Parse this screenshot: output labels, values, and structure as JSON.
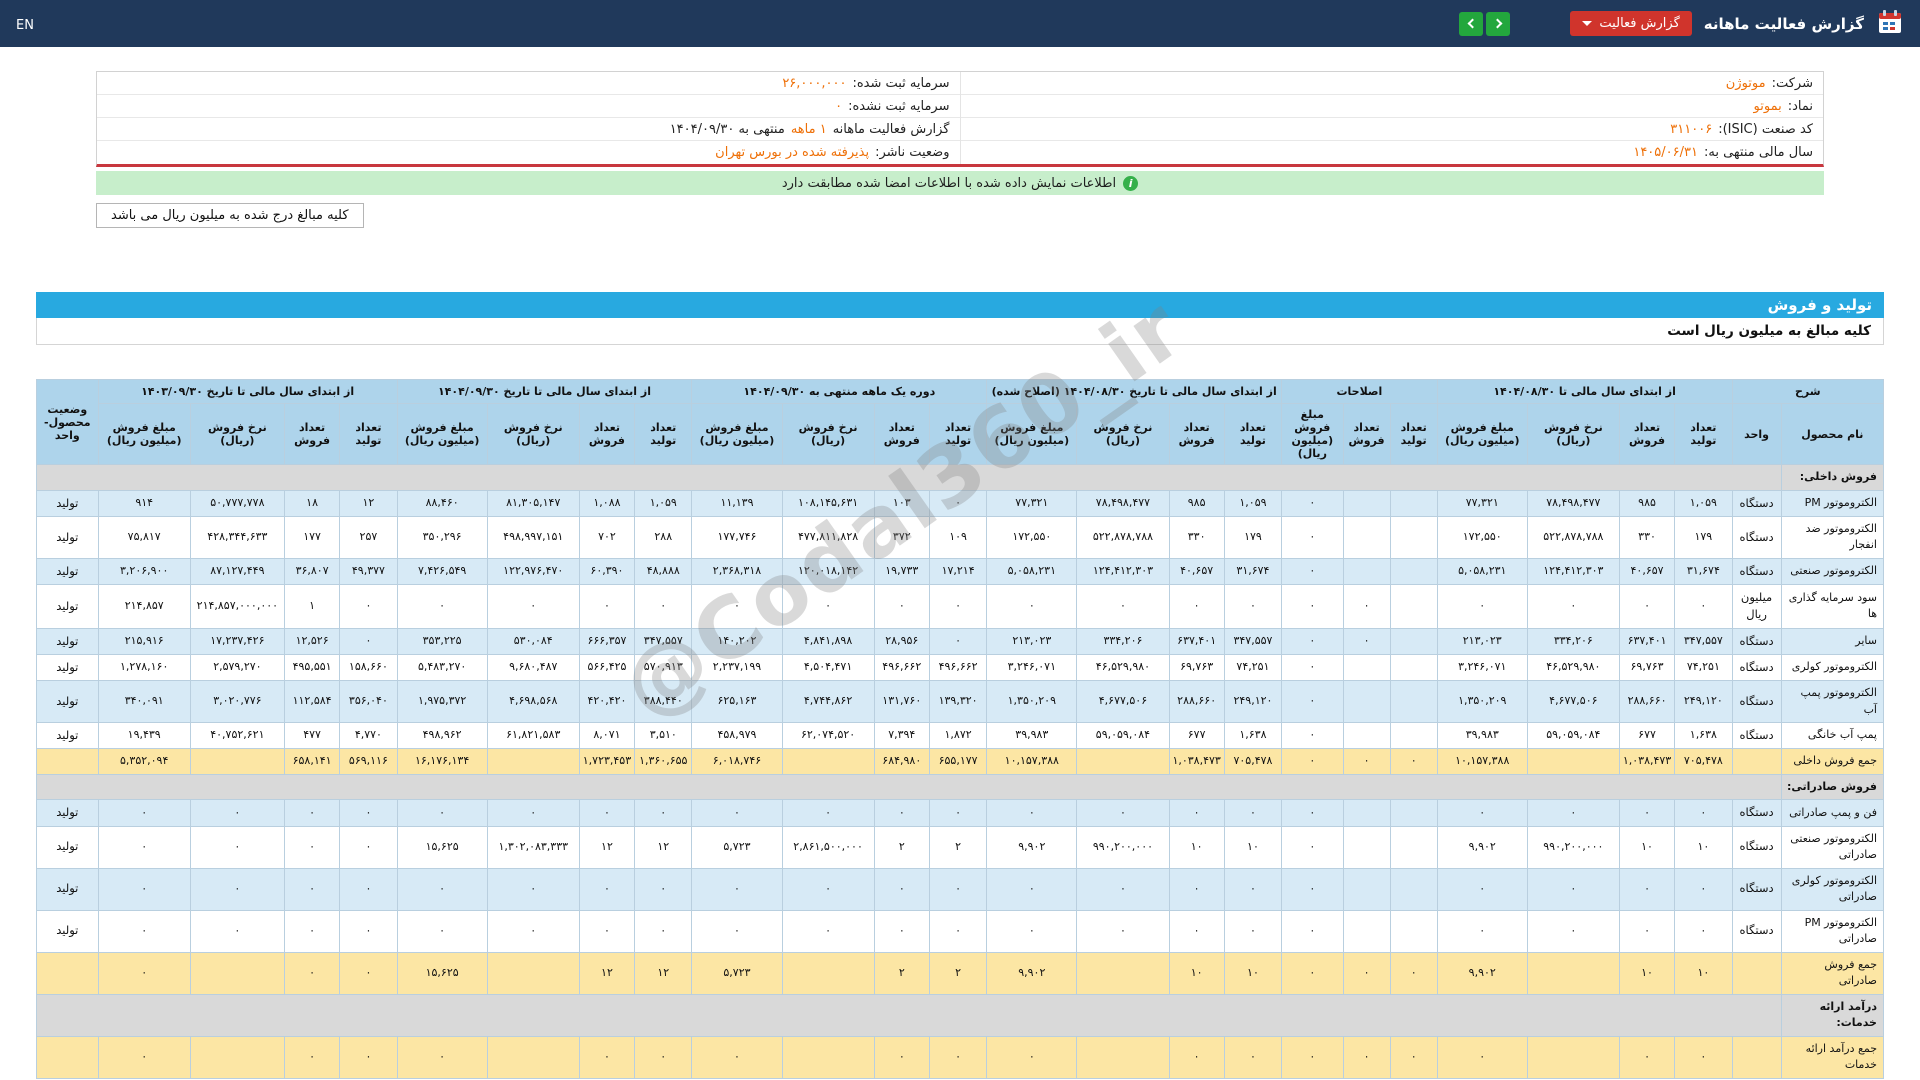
{
  "topbar": {
    "title": "گزارش فعالیت ماهانه",
    "report_button": "گزارش فعالیت",
    "lang": "EN"
  },
  "icons": {
    "info": "i"
  },
  "info": {
    "right": [
      {
        "label": "شرکت:",
        "value": "موتوژن"
      },
      {
        "label": "نماد:",
        "value": "بموتو"
      },
      {
        "label": "کد صنعت (ISIC):",
        "value": "۳۱۱۰۰۶"
      },
      {
        "label": "سال مالی منتهی به:",
        "value": "۱۴۰۵/۰۶/۳۱"
      }
    ],
    "left": [
      {
        "label": "سرمایه ثبت شده:",
        "value": "۲۶,۰۰۰,۰۰۰",
        "post": ""
      },
      {
        "label": "سرمایه ثبت نشده:",
        "value": "۰",
        "post": ""
      },
      {
        "label": "گزارش فعالیت ماهانه",
        "value": "۱ ماهه",
        "post": "منتهی به ۱۴۰۴/۰۹/۳۰"
      },
      {
        "label": "وضعیت ناشر:",
        "value": "پذیرفته شده در بورس تهران",
        "post": ""
      }
    ]
  },
  "banner": {
    "text": "اطلاعات نمایش داده شده با اطلاعات امضا شده مطابقت دارد"
  },
  "note": "کلیه مبالغ درج شده به میلیون ریال می باشد",
  "section_title": "تولید و فروش",
  "subtitle": "کلیه مبالغ به میلیون ریال است",
  "watermark": "@Codal360_ir",
  "table": {
    "groups": [
      {
        "title": "شرح",
        "cols": [
          "نام محصول",
          "واحد"
        ]
      },
      {
        "title": "از ابتدای سال مالی تا ۱۴۰۴/۰۸/۳۰",
        "cols": [
          "تعداد تولید",
          "تعداد فروش",
          "نرخ فروش (ریال)",
          "مبلغ فروش (میلیون ریال)"
        ]
      },
      {
        "title": "اصلاحات",
        "cols": [
          "تعداد تولید",
          "تعداد فروش",
          "مبلغ فروش (میلیون ریال)"
        ]
      },
      {
        "title": "از ابتدای سال مالی تا تاریخ ۱۴۰۴/۰۸/۳۰ (اصلاح شده)",
        "cols": [
          "تعداد تولید",
          "تعداد فروش",
          "نرخ فروش (ریال)",
          "مبلغ فروش (میلیون ریال)"
        ]
      },
      {
        "title": "دوره یک ماهه منتهی به ۱۴۰۴/۰۹/۳۰",
        "cols": [
          "تعداد تولید",
          "تعداد فروش",
          "نرخ فروش (ریال)",
          "مبلغ فروش (میلیون ریال)"
        ]
      },
      {
        "title": "از ابتدای سال مالی تا تاریخ ۱۴۰۴/۰۹/۳۰",
        "cols": [
          "تعداد تولید",
          "تعداد فروش",
          "نرخ فروش (ریال)",
          "مبلغ فروش (میلیون ریال)"
        ]
      },
      {
        "title": "از ابتدای سال مالی تا تاریخ ۱۴۰۳/۰۹/۳۰",
        "cols": [
          "تعداد تولید",
          "تعداد فروش",
          "نرخ فروش (ریال)",
          "مبلغ فروش (میلیون ریال)"
        ]
      },
      {
        "title": "وضعیت محصول-واحد",
        "cols": []
      }
    ],
    "rows": [
      {
        "type": "section",
        "name": "فروش داخلی:"
      },
      {
        "type": "data",
        "shade": "b",
        "name": "الکتروموتور PM",
        "unit": "دستگاه",
        "status": "تولید",
        "g2": [
          "۱,۰۵۹",
          "۹۸۵",
          "۷۸,۴۹۸,۴۷۷",
          "۷۷,۳۲۱"
        ],
        "adj": [
          "",
          "",
          "۰"
        ],
        "g4": [
          "۱,۰۵۹",
          "۹۸۵",
          "۷۸,۴۹۸,۴۷۷",
          "۷۷,۳۲۱"
        ],
        "m": [
          "۰",
          "۱۰۳",
          "۱۰۸,۱۴۵,۶۳۱",
          "۱۱,۱۳۹"
        ],
        "g6": [
          "۱,۰۵۹",
          "۱,۰۸۸",
          "۸۱,۳۰۵,۱۴۷",
          "۸۸,۴۶۰"
        ],
        "g7": [
          "۱۲",
          "۱۸",
          "۵۰,۷۷۷,۷۷۸",
          "۹۱۴"
        ]
      },
      {
        "type": "data",
        "shade": "w",
        "name": "الکتروموتور ضد انفجار",
        "unit": "دستگاه",
        "status": "تولید",
        "g2": [
          "۱۷۹",
          "۳۳۰",
          "۵۲۲,۸۷۸,۷۸۸",
          "۱۷۲,۵۵۰"
        ],
        "adj": [
          "",
          "",
          "۰"
        ],
        "g4": [
          "۱۷۹",
          "۳۳۰",
          "۵۲۲,۸۷۸,۷۸۸",
          "۱۷۲,۵۵۰"
        ],
        "m": [
          "۱۰۹",
          "۳۷۲",
          "۴۷۷,۸۱۱,۸۲۸",
          "۱۷۷,۷۴۶"
        ],
        "g6": [
          "۲۸۸",
          "۷۰۲",
          "۴۹۸,۹۹۷,۱۵۱",
          "۳۵۰,۲۹۶"
        ],
        "g7": [
          "۲۵۷",
          "۱۷۷",
          "۴۲۸,۳۴۴,۶۳۳",
          "۷۵,۸۱۷"
        ]
      },
      {
        "type": "data",
        "shade": "b",
        "name": "الکتروموتور صنعتی",
        "unit": "دستگاه",
        "status": "تولید",
        "g2": [
          "۳۱,۶۷۴",
          "۴۰,۶۵۷",
          "۱۲۴,۴۱۲,۳۰۳",
          "۵,۰۵۸,۲۳۱"
        ],
        "adj": [
          "",
          "",
          "۰"
        ],
        "g4": [
          "۳۱,۶۷۴",
          "۴۰,۶۵۷",
          "۱۲۴,۴۱۲,۳۰۳",
          "۵,۰۵۸,۲۳۱"
        ],
        "m": [
          "۱۷,۲۱۴",
          "۱۹,۷۳۳",
          "۱۲۰,۰۱۸,۱۴۲",
          "۲,۳۶۸,۳۱۸"
        ],
        "g6": [
          "۴۸,۸۸۸",
          "۶۰,۳۹۰",
          "۱۲۲,۹۷۶,۴۷۰",
          "۷,۴۲۶,۵۴۹"
        ],
        "g7": [
          "۴۹,۳۷۷",
          "۳۶,۸۰۷",
          "۸۷,۱۲۷,۴۴۹",
          "۳,۲۰۶,۹۰۰"
        ]
      },
      {
        "type": "data",
        "shade": "w",
        "name": "سود سرمایه گذاری ها",
        "unit": "میلیون ریال",
        "status": "تولید",
        "g2": [
          "۰",
          "۰",
          "۰",
          "۰"
        ],
        "adj": [
          "",
          "۰",
          "۰"
        ],
        "g4": [
          "۰",
          "۰",
          "۰",
          "۰"
        ],
        "m": [
          "۰",
          "۰",
          "۰",
          "۰"
        ],
        "g6": [
          "۰",
          "۰",
          "۰",
          "۰"
        ],
        "g7": [
          "۰",
          "۱",
          "۲۱۴,۸۵۷,۰۰۰,۰۰۰",
          "۲۱۴,۸۵۷"
        ]
      },
      {
        "type": "data",
        "shade": "b",
        "name": "سایر",
        "unit": "دستگاه",
        "status": "تولید",
        "g2": [
          "۳۴۷,۵۵۷",
          "۶۳۷,۴۰۱",
          "۳۳۴,۲۰۶",
          "۲۱۳,۰۲۳"
        ],
        "adj": [
          "",
          "۰",
          "۰"
        ],
        "g4": [
          "۳۴۷,۵۵۷",
          "۶۳۷,۴۰۱",
          "۳۳۴,۲۰۶",
          "۲۱۳,۰۲۳"
        ],
        "m": [
          "۰",
          "۲۸,۹۵۶",
          "۴,۸۴۱,۸۹۸",
          "۱۴۰,۲۰۲"
        ],
        "g6": [
          "۳۴۷,۵۵۷",
          "۶۶۶,۳۵۷",
          "۵۳۰,۰۸۴",
          "۳۵۳,۲۲۵"
        ],
        "g7": [
          "۰",
          "۱۲,۵۲۶",
          "۱۷,۲۳۷,۴۲۶",
          "۲۱۵,۹۱۶"
        ]
      },
      {
        "type": "data",
        "shade": "w",
        "name": "الکتروموتور کولری",
        "unit": "دستگاه",
        "status": "تولید",
        "g2": [
          "۷۴,۲۵۱",
          "۶۹,۷۶۳",
          "۴۶,۵۲۹,۹۸۰",
          "۳,۲۴۶,۰۷۱"
        ],
        "adj": [
          "",
          "",
          "۰"
        ],
        "g4": [
          "۷۴,۲۵۱",
          "۶۹,۷۶۳",
          "۴۶,۵۲۹,۹۸۰",
          "۳,۲۴۶,۰۷۱"
        ],
        "m": [
          "۴۹۶,۶۶۲",
          "۴۹۶,۶۶۲",
          "۴,۵۰۴,۴۷۱",
          "۲,۲۳۷,۱۹۹"
        ],
        "g6": [
          "۵۷۰,۹۱۳",
          "۵۶۶,۴۲۵",
          "۹,۶۸۰,۴۸۷",
          "۵,۴۸۳,۲۷۰"
        ],
        "g7": [
          "۱۵۸,۶۶۰",
          "۴۹۵,۵۵۱",
          "۲,۵۷۹,۲۷۰",
          "۱,۲۷۸,۱۶۰"
        ]
      },
      {
        "type": "data",
        "shade": "b",
        "name": "الکتروموتور پمپ آب",
        "unit": "دستگاه",
        "status": "تولید",
        "g2": [
          "۲۴۹,۱۲۰",
          "۲۸۸,۶۶۰",
          "۴,۶۷۷,۵۰۶",
          "۱,۳۵۰,۲۰۹"
        ],
        "adj": [
          "",
          "",
          "۰"
        ],
        "g4": [
          "۲۴۹,۱۲۰",
          "۲۸۸,۶۶۰",
          "۴,۶۷۷,۵۰۶",
          "۱,۳۵۰,۲۰۹"
        ],
        "m": [
          "۱۳۹,۳۲۰",
          "۱۳۱,۷۶۰",
          "۴,۷۴۴,۸۶۲",
          "۶۲۵,۱۶۳"
        ],
        "g6": [
          "۳۸۸,۴۴۰",
          "۴۲۰,۴۲۰",
          "۴,۶۹۸,۵۶۸",
          "۱,۹۷۵,۳۷۲"
        ],
        "g7": [
          "۳۵۶,۰۴۰",
          "۱۱۲,۵۸۴",
          "۳,۰۲۰,۷۷۶",
          "۳۴۰,۰۹۱"
        ]
      },
      {
        "type": "data",
        "shade": "w",
        "name": "پمپ آب خانگی",
        "unit": "دستگاه",
        "status": "تولید",
        "g2": [
          "۱,۶۳۸",
          "۶۷۷",
          "۵۹,۰۵۹,۰۸۴",
          "۳۹,۹۸۳"
        ],
        "adj": [
          "",
          "",
          "۰"
        ],
        "g4": [
          "۱,۶۳۸",
          "۶۷۷",
          "۵۹,۰۵۹,۰۸۴",
          "۳۹,۹۸۳"
        ],
        "m": [
          "۱,۸۷۲",
          "۷,۳۹۴",
          "۶۲,۰۷۴,۵۲۰",
          "۴۵۸,۹۷۹"
        ],
        "g6": [
          "۳,۵۱۰",
          "۸,۰۷۱",
          "۶۱,۸۲۱,۵۸۳",
          "۴۹۸,۹۶۲"
        ],
        "g7": [
          "۴,۷۷۰",
          "۴۷۷",
          "۴۰,۷۵۲,۶۲۱",
          "۱۹,۴۳۹"
        ]
      },
      {
        "type": "total",
        "name": "جمع فروش داخلی",
        "unit": "",
        "status": "",
        "g2": [
          "۷۰۵,۴۷۸",
          "۱,۰۳۸,۴۷۳",
          "",
          "۱۰,۱۵۷,۳۸۸"
        ],
        "adj": [
          "۰",
          "۰",
          "۰"
        ],
        "g4": [
          "۷۰۵,۴۷۸",
          "۱,۰۳۸,۴۷۳",
          "",
          "۱۰,۱۵۷,۳۸۸"
        ],
        "m": [
          "۶۵۵,۱۷۷",
          "۶۸۴,۹۸۰",
          "",
          "۶,۰۱۸,۷۴۶"
        ],
        "g6": [
          "۱,۳۶۰,۶۵۵",
          "۱,۷۲۳,۴۵۳",
          "",
          "۱۶,۱۷۶,۱۳۴"
        ],
        "g7": [
          "۵۶۹,۱۱۶",
          "۶۵۸,۱۴۱",
          "",
          "۵,۳۵۲,۰۹۴"
        ]
      },
      {
        "type": "section",
        "name": "فروش صادراتی:"
      },
      {
        "type": "data",
        "shade": "b",
        "name": "فن و پمپ صادراتی",
        "unit": "دستگاه",
        "status": "تولید",
        "g2": [
          "۰",
          "۰",
          "۰",
          "۰"
        ],
        "adj": [
          "",
          "",
          "۰"
        ],
        "g4": [
          "۰",
          "۰",
          "۰",
          "۰"
        ],
        "m": [
          "۰",
          "۰",
          "۰",
          "۰"
        ],
        "g6": [
          "۰",
          "۰",
          "۰",
          "۰"
        ],
        "g7": [
          "۰",
          "۰",
          "۰",
          "۰"
        ]
      },
      {
        "type": "data",
        "shade": "w",
        "name": "الکتروموتور صنعتی صادراتی",
        "unit": "دستگاه",
        "status": "تولید",
        "g2": [
          "۱۰",
          "۱۰",
          "۹۹۰,۲۰۰,۰۰۰",
          "۹,۹۰۲"
        ],
        "adj": [
          "",
          "",
          "۰"
        ],
        "g4": [
          "۱۰",
          "۱۰",
          "۹۹۰,۲۰۰,۰۰۰",
          "۹,۹۰۲"
        ],
        "m": [
          "۲",
          "۲",
          "۲,۸۶۱,۵۰۰,۰۰۰",
          "۵,۷۲۳"
        ],
        "g6": [
          "۱۲",
          "۱۲",
          "۱,۳۰۲,۰۸۳,۳۳۳",
          "۱۵,۶۲۵"
        ],
        "g7": [
          "۰",
          "۰",
          "۰",
          "۰"
        ]
      },
      {
        "type": "data",
        "shade": "b",
        "name": "الکتروموتور کولری صادراتی",
        "unit": "دستگاه",
        "status": "تولید",
        "g2": [
          "۰",
          "۰",
          "۰",
          "۰"
        ],
        "adj": [
          "",
          "",
          "۰"
        ],
        "g4": [
          "۰",
          "۰",
          "۰",
          "۰"
        ],
        "m": [
          "۰",
          "۰",
          "۰",
          "۰"
        ],
        "g6": [
          "۰",
          "۰",
          "۰",
          "۰"
        ],
        "g7": [
          "۰",
          "۰",
          "۰",
          "۰"
        ]
      },
      {
        "type": "data",
        "shade": "w",
        "name": "الکتروموتور PM صادراتی",
        "unit": "دستگاه",
        "status": "تولید",
        "g2": [
          "۰",
          "۰",
          "۰",
          "۰"
        ],
        "adj": [
          "",
          "",
          "۰"
        ],
        "g4": [
          "۰",
          "۰",
          "۰",
          "۰"
        ],
        "m": [
          "۰",
          "۰",
          "۰",
          "۰"
        ],
        "g6": [
          "۰",
          "۰",
          "۰",
          "۰"
        ],
        "g7": [
          "۰",
          "۰",
          "۰",
          "۰"
        ]
      },
      {
        "type": "total",
        "name": "جمع فروش صادراتی",
        "unit": "",
        "status": "",
        "g2": [
          "۱۰",
          "۱۰",
          "",
          "۹,۹۰۲"
        ],
        "adj": [
          "۰",
          "۰",
          "۰"
        ],
        "g4": [
          "۱۰",
          "۱۰",
          "",
          "۹,۹۰۲"
        ],
        "m": [
          "۲",
          "۲",
          "",
          "۵,۷۲۳"
        ],
        "g6": [
          "۱۲",
          "۱۲",
          "",
          "۱۵,۶۲۵"
        ],
        "g7": [
          "۰",
          "۰",
          "",
          "۰"
        ]
      },
      {
        "type": "section",
        "name": "درآمد ارائه خدمات:"
      },
      {
        "type": "total",
        "name": "جمع درآمد ارائه خدمات",
        "unit": "",
        "status": "",
        "g2": [
          "۰",
          "۰",
          "",
          "۰"
        ],
        "adj": [
          "۰",
          "۰",
          "۰"
        ],
        "g4": [
          "۰",
          "۰",
          "",
          "۰"
        ],
        "m": [
          "۰",
          "۰",
          "",
          "۰"
        ],
        "g6": [
          "۰",
          "۰",
          "",
          "۰"
        ],
        "g7": [
          "۰",
          "۰",
          "",
          "۰"
        ]
      }
    ]
  }
}
